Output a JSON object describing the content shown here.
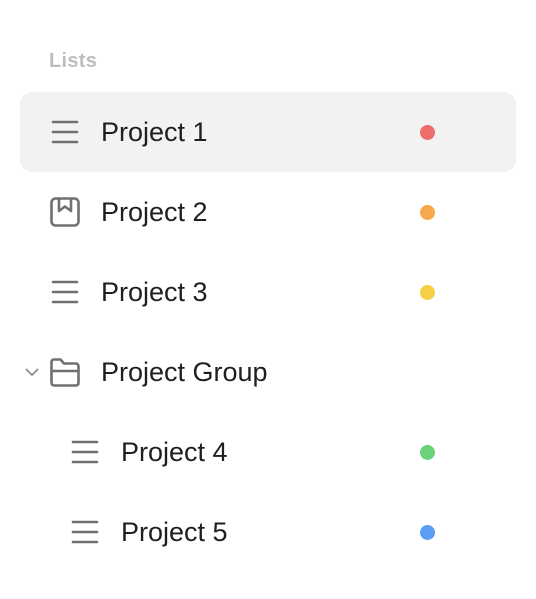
{
  "section": {
    "title": "Lists"
  },
  "lists": [
    {
      "label": "Project 1",
      "icon": "list-icon",
      "color": "#f06b6b",
      "selected": true
    },
    {
      "label": "Project 2",
      "icon": "bookmark-box-icon",
      "color": "#f5a94a"
    },
    {
      "label": "Project 3",
      "icon": "list-icon",
      "color": "#f5cf45"
    },
    {
      "label": "Project Group",
      "icon": "folder-open-icon",
      "expanded": true
    },
    {
      "label": "Project 4",
      "icon": "list-icon",
      "color": "#6ad37a"
    },
    {
      "label": "Project 5",
      "icon": "list-icon",
      "color": "#5b9cf5"
    }
  ]
}
